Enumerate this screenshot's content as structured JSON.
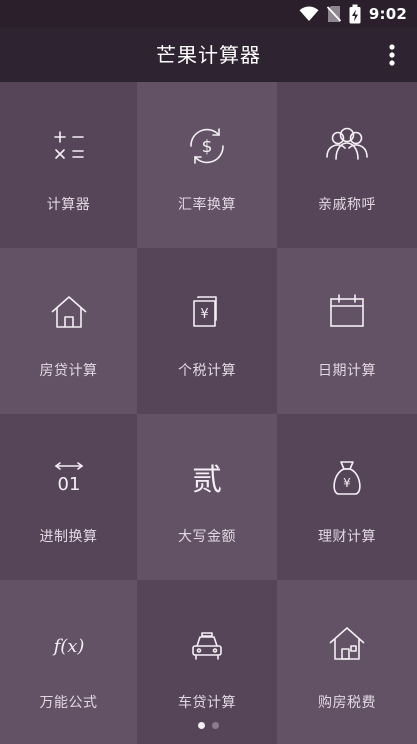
{
  "status_bar": {
    "time": "9:02",
    "icons": [
      "wifi-icon",
      "no-sim-icon",
      "battery-charging-icon"
    ]
  },
  "app_bar": {
    "title": "芒果计算器",
    "menu_icon": "more-vert-icon"
  },
  "tiles": [
    {
      "label": "计算器",
      "icon": "calculator-icon"
    },
    {
      "label": "汇率换算",
      "icon": "currency-exchange-icon"
    },
    {
      "label": "亲戚称呼",
      "icon": "relatives-icon"
    },
    {
      "label": "房贷计算",
      "icon": "house-icon"
    },
    {
      "label": "个税计算",
      "icon": "tax-document-icon"
    },
    {
      "label": "日期计算",
      "icon": "calendar-icon"
    },
    {
      "label": "进制换算",
      "icon": "base-conversion-icon"
    },
    {
      "label": "大写金额",
      "icon": "chinese-numeral-icon"
    },
    {
      "label": "理财计算",
      "icon": "money-bag-icon"
    },
    {
      "label": "万能公式",
      "icon": "formula-icon"
    },
    {
      "label": "车贷计算",
      "icon": "car-icon"
    },
    {
      "label": "购房税费",
      "icon": "home-tax-icon"
    }
  ],
  "tile_icon_glyphs": {
    "tax_document": "¥",
    "base_conversion": "01",
    "chinese_numeral": "贰",
    "money_bag": "¥",
    "formula": "f(x)"
  },
  "pager": {
    "pages": 2,
    "current": 1
  },
  "colors": {
    "status_bar": "#2a1f2b",
    "app_bar": "#2e2330",
    "tile_dark": "#564558",
    "tile_light": "#635165",
    "icon_stroke": "#f4eff5",
    "label_text": "#e2d8e3"
  }
}
